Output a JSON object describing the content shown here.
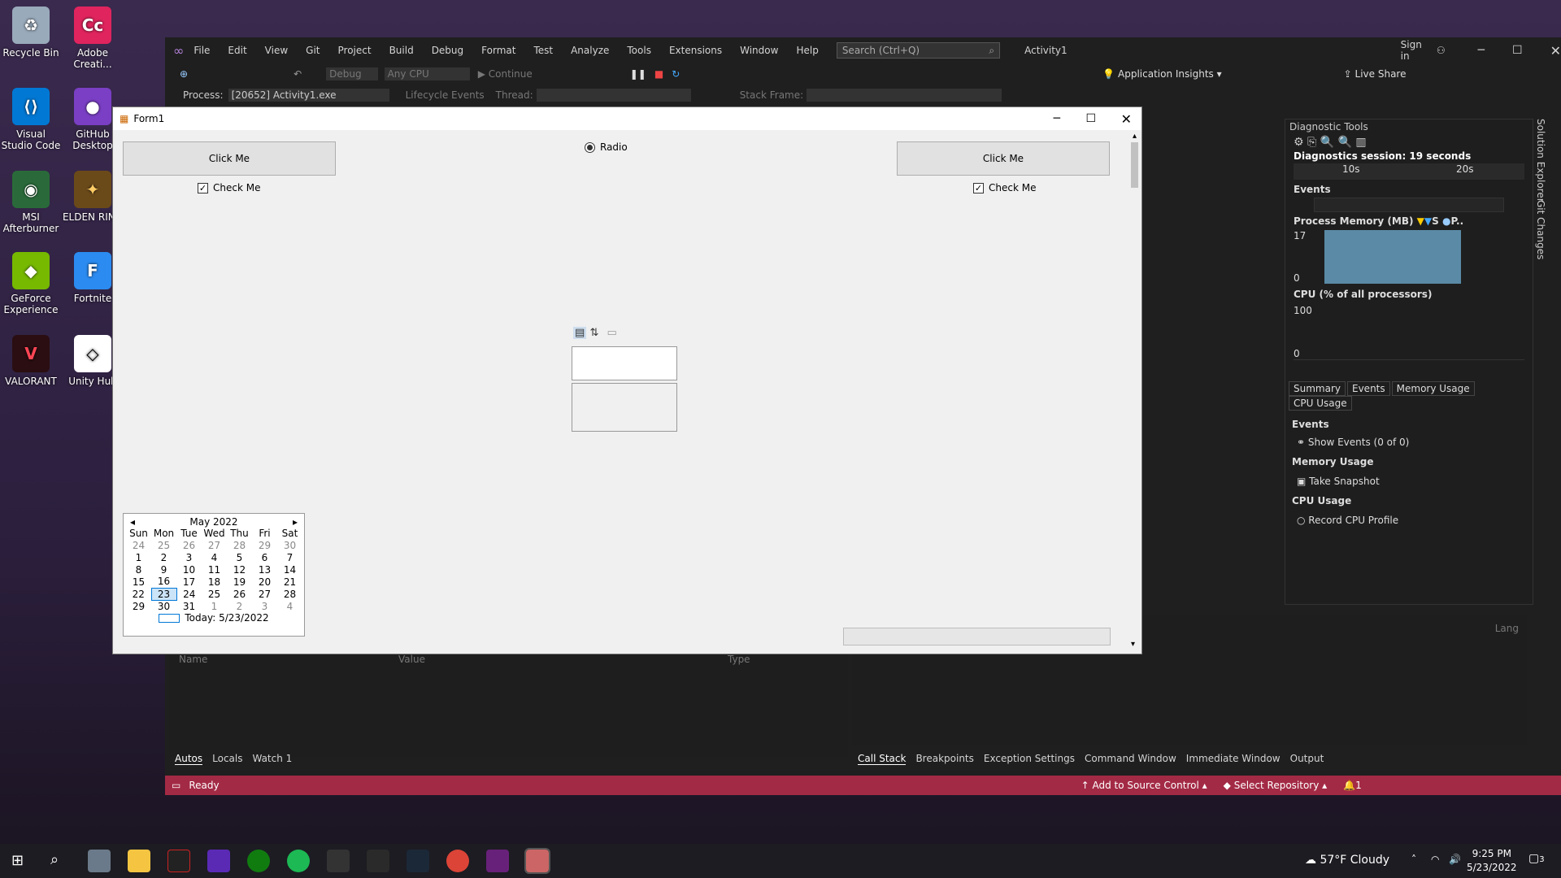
{
  "desktop": {
    "icons": [
      {
        "label": "Recycle Bin",
        "icon": "recycle-bin-icon"
      },
      {
        "label": "Adobe Creati...",
        "icon": "adobe-cc-icon"
      },
      {
        "label": "Visual Studio Code",
        "icon": "vscode-icon"
      },
      {
        "label": "GitHub Desktop",
        "icon": "github-icon"
      },
      {
        "label": "MSI Afterburner",
        "icon": "msi-icon"
      },
      {
        "label": "ELDEN RING",
        "icon": "elden-ring-icon"
      },
      {
        "label": "GeForce Experience",
        "icon": "geforce-icon"
      },
      {
        "label": "Fortnite",
        "icon": "fortnite-icon"
      },
      {
        "label": "VALORANT",
        "icon": "valorant-icon"
      },
      {
        "label": "Unity Hub",
        "icon": "unity-icon"
      }
    ]
  },
  "vs": {
    "menu": [
      "File",
      "Edit",
      "View",
      "Git",
      "Project",
      "Build",
      "Debug",
      "Format",
      "Test",
      "Analyze",
      "Tools",
      "Extensions",
      "Window",
      "Help"
    ],
    "search_placeholder": "Search (Ctrl+Q)",
    "solution": "Activity1",
    "sign_in": "Sign in",
    "toolbar": {
      "config": "Debug",
      "platform": "Any CPU",
      "continue": "Continue",
      "app_insights": "Application Insights",
      "live_share": "Live Share"
    },
    "process_label": "Process:",
    "process_value": "[20652] Activity1.exe",
    "lifecycle": "Lifecycle Events",
    "thread": "Thread:",
    "stack_frame": "Stack Frame:",
    "autos_cols": [
      "Name",
      "Value",
      "Type"
    ],
    "bottom_left_tabs": [
      "Autos",
      "Locals",
      "Watch 1"
    ],
    "bottom_right_tabs": [
      "Call Stack",
      "Breakpoints",
      "Exception Settings",
      "Command Window",
      "Immediate Window",
      "Output"
    ],
    "lang_label": "Lang",
    "status": "Ready",
    "add_source": "Add to Source Control",
    "select_repo": "Select Repository",
    "notif_count": "1",
    "side_tabs": [
      "Solution Explorer",
      "Git Changes"
    ]
  },
  "diag": {
    "title": "Diagnostic Tools",
    "session": "Diagnostics session: 19 seconds",
    "ticks": [
      "10s",
      "20s"
    ],
    "events_label": "Events",
    "memory_label": "Process Memory (MB)",
    "memory_legend": [
      "S",
      "P.."
    ],
    "mem_max": "17",
    "mem_min": "0",
    "cpu_label": "CPU (% of all processors)",
    "cpu_max": "100",
    "cpu_min": "0",
    "tabs": [
      "Summary",
      "Events",
      "Memory Usage",
      "CPU Usage"
    ],
    "sections": {
      "events": "Events",
      "show_events": "Show Events (0 of 0)",
      "memory": "Memory Usage",
      "snapshot": "Take Snapshot",
      "cpu": "CPU Usage",
      "record": "Record CPU Profile"
    }
  },
  "form": {
    "title": "Form1",
    "button1": "Click Me",
    "button2": "Click Me",
    "check1": "Check Me",
    "check2": "Check Me",
    "radio": "Radio",
    "calendar": {
      "month": "May 2022",
      "days": [
        "Sun",
        "Mon",
        "Tue",
        "Wed",
        "Thu",
        "Fri",
        "Sat"
      ],
      "weeks": [
        [
          "24",
          "25",
          "26",
          "27",
          "28",
          "29",
          "30"
        ],
        [
          "1",
          "2",
          "3",
          "4",
          "5",
          "6",
          "7"
        ],
        [
          "8",
          "9",
          "10",
          "11",
          "12",
          "13",
          "14"
        ],
        [
          "15",
          "16",
          "17",
          "18",
          "19",
          "20",
          "21"
        ],
        [
          "22",
          "23",
          "24",
          "25",
          "26",
          "27",
          "28"
        ],
        [
          "29",
          "30",
          "31",
          "1",
          "2",
          "3",
          "4"
        ]
      ],
      "today": "Today: 5/23/2022",
      "selected": "23"
    }
  },
  "taskbar": {
    "weather": "57°F  Cloudy",
    "time": "9:25 PM",
    "date": "5/23/2022",
    "notif": "3"
  }
}
